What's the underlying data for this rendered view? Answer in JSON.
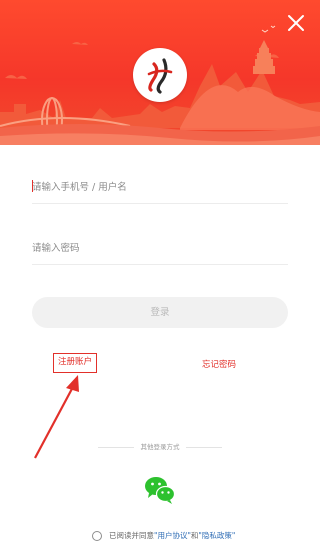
{
  "colors": {
    "header_red": "#f5372a",
    "accent_red": "#e2302a",
    "link_blue": "#2f6db5",
    "wechat_green": "#2dc12e",
    "button_gray": "#f1f1f1"
  },
  "header": {
    "close_icon": "close-icon",
    "logo_icon": "app-logo"
  },
  "form": {
    "account_placeholder": "请输入手机号 / 用户名",
    "password_placeholder": "请输入密码",
    "login_label": "登录"
  },
  "links": {
    "register": "注册账户",
    "forgot_password": "忘记密码"
  },
  "other_login": {
    "title": "其他登录方式",
    "wechat_icon": "wechat-icon"
  },
  "agreement": {
    "prefix": "已阅读并同意",
    "user_agreement": "\"用户协议\"",
    "and": "和",
    "privacy_policy": "\"隐私政策\""
  }
}
